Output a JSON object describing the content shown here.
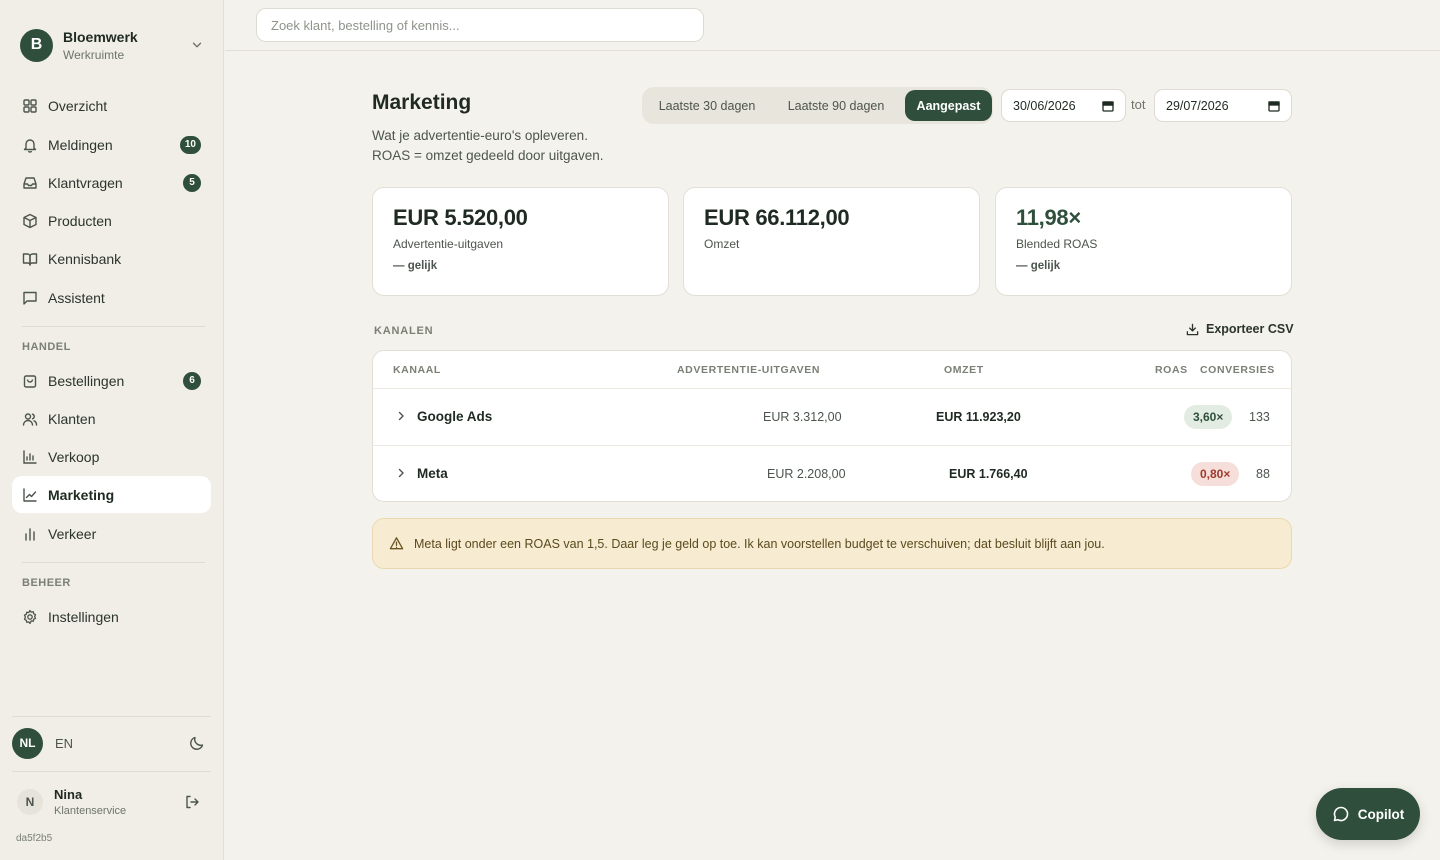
{
  "workspace": {
    "initial": "B",
    "name": "Bloemwerk",
    "subtitle": "Werkruimte"
  },
  "nav_main": [
    {
      "label": "Overzicht",
      "icon": "grid-icon",
      "badge": ""
    },
    {
      "label": "Meldingen",
      "icon": "bell-icon",
      "badge": "10"
    },
    {
      "label": "Klantvragen",
      "icon": "inbox-icon",
      "badge": "5"
    },
    {
      "label": "Producten",
      "icon": "box-icon",
      "badge": ""
    },
    {
      "label": "Kennisbank",
      "icon": "book-icon",
      "badge": ""
    },
    {
      "label": "Assistent",
      "icon": "chat-icon",
      "badge": ""
    }
  ],
  "section_handel": "HANDEL",
  "nav_handel": [
    {
      "label": "Bestellingen",
      "icon": "bag-icon",
      "badge": "6"
    },
    {
      "label": "Klanten",
      "icon": "users-icon",
      "badge": ""
    },
    {
      "label": "Verkoop",
      "icon": "bar-chart-icon",
      "badge": ""
    },
    {
      "label": "Marketing",
      "icon": "trend-icon",
      "badge": ""
    },
    {
      "label": "Verkeer",
      "icon": "bars-icon",
      "badge": ""
    }
  ],
  "section_beheer": "BEHEER",
  "nav_beheer": [
    {
      "label": "Instellingen",
      "icon": "gear-icon",
      "badge": ""
    }
  ],
  "active_nav": "Marketing",
  "lang": {
    "active": "NL",
    "other": "EN"
  },
  "user": {
    "initial": "N",
    "name": "Nina",
    "role": "Klantenservice"
  },
  "build": "da5f2b5",
  "search": {
    "placeholder": "Zoek klant, bestelling of kennis...",
    "value": ""
  },
  "page": {
    "title": "Marketing",
    "desc_line1": "Wat je advertentie-euro's opleveren.",
    "desc_line2": "ROAS = omzet gedeeld door uitgaven."
  },
  "range": {
    "options": [
      "Laatste 30 dagen",
      "Laatste 90 dagen",
      "Aangepast"
    ],
    "selected": "Aangepast",
    "from": "30/06/2026",
    "to_label": "tot",
    "to": "29/07/2026"
  },
  "kpis": [
    {
      "value": "EUR 5.520,00",
      "label": "Advertentie-uitgaven",
      "delta": "— gelijk"
    },
    {
      "value": "EUR 66.112,00",
      "label": "Omzet",
      "delta": ""
    },
    {
      "value": "11,98×",
      "label": "Blended ROAS",
      "delta": "— gelijk"
    }
  ],
  "channels": {
    "title": "KANALEN",
    "export_label": "Exporteer CSV",
    "headers": [
      "KANAAL",
      "ADVERTENTIE-UITGAVEN",
      "OMZET",
      "ROAS",
      "CONVERSIES"
    ],
    "rows": [
      {
        "name": "Google Ads",
        "spend": "EUR 3.312,00",
        "revenue": "EUR 11.923,20",
        "roas": "3,60×",
        "roas_status": "good",
        "conversions": "133"
      },
      {
        "name": "Meta",
        "spend": "EUR 2.208,00",
        "revenue": "EUR 1.766,40",
        "roas": "0,80×",
        "roas_status": "bad",
        "conversions": "88"
      }
    ]
  },
  "alert": "Meta ligt onder een ROAS van 1,5. Daar leg je geld op toe. Ik kan voorstellen budget te verschuiven; dat besluit blijft aan jou.",
  "copilot_label": "Copilot",
  "colors": {
    "accent": "#2f4f3c",
    "warning_bg": "#f7ecd2",
    "bad": "#a03a2c"
  }
}
